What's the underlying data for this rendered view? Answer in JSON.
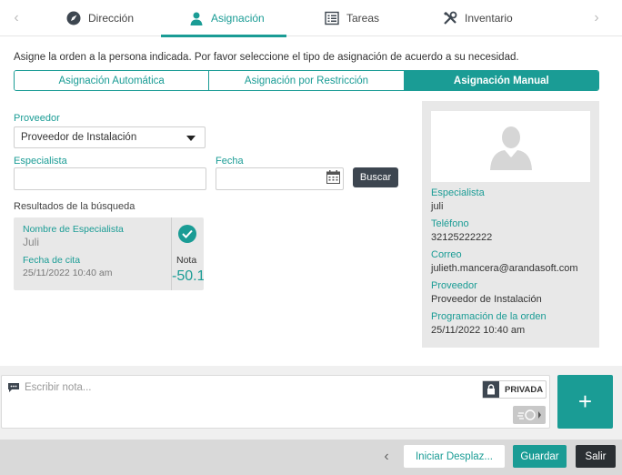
{
  "tabs": [
    {
      "label": "Dirección",
      "icon": "compass-icon"
    },
    {
      "label": "Asignación",
      "icon": "person-icon"
    },
    {
      "label": "Tareas",
      "icon": "checklist-icon"
    },
    {
      "label": "Inventario",
      "icon": "tools-icon"
    }
  ],
  "active_tab": "Asignación",
  "instruction": "Asigne la orden a la persona indicada. Por favor seleccione el tipo de asignación de acuerdo a su necesidad.",
  "assignment_types": [
    {
      "label": "Asignación Automática",
      "active": false
    },
    {
      "label": "Asignación por Restricción",
      "active": false
    },
    {
      "label": "Asignación Manual",
      "active": true
    }
  ],
  "form": {
    "proveedor_label": "Proveedor",
    "proveedor_value": "Proveedor de Instalación",
    "especialista_label": "Especialista",
    "especialista_value": "",
    "fecha_label": "Fecha",
    "fecha_value": "",
    "buscar_label": "Buscar"
  },
  "results": {
    "title": "Resultados de la búsqueda",
    "items": [
      {
        "name_label": "Nombre de Especialista",
        "name": "Juli",
        "date_label": "Fecha de cita",
        "date": "25/11/2022 10:40 am",
        "nota_label": "Nota",
        "score": "-50.1",
        "selected": true
      }
    ]
  },
  "detail": {
    "especialista_label": "Especialista",
    "especialista": "juli",
    "telefono_label": "Teléfono",
    "telefono": "32125222222",
    "correo_label": "Correo",
    "correo": "julieth.mancera@arandasoft.com",
    "proveedor_label": "Proveedor",
    "proveedor": "Proveedor de Instalación",
    "programacion_label": "Programación de la orden",
    "programacion": "25/11/2022 10:40 am"
  },
  "note": {
    "placeholder": "Escribir nota...",
    "privada_label": "PRIVADA",
    "add_label": "+"
  },
  "footer": {
    "iniciar_label": "Iniciar Desplaz...",
    "guardar_label": "Guardar",
    "salir_label": "Salir"
  },
  "colors": {
    "accent": "#1a9c95",
    "dark": "#3d4650",
    "panel": "#e8e8e8"
  }
}
